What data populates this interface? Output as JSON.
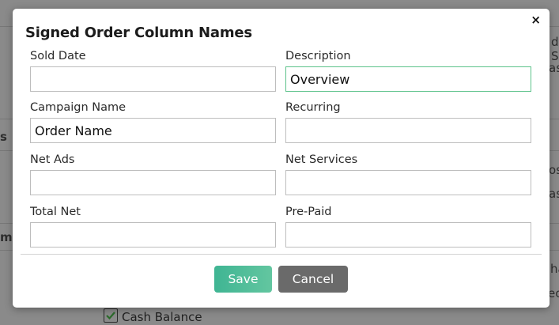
{
  "modal": {
    "title": "Signed Order Column Names",
    "close_label": "×",
    "fields": [
      {
        "label": "Sold Date",
        "value": ""
      },
      {
        "label": "Description",
        "value": "Overview"
      },
      {
        "label": "Campaign Name",
        "value": "Order Name"
      },
      {
        "label": "Recurring",
        "value": ""
      },
      {
        "label": "Net Ads",
        "value": ""
      },
      {
        "label": "Net Services",
        "value": ""
      },
      {
        "label": "Total Net",
        "value": ""
      },
      {
        "label": "Pre-Paid",
        "value": ""
      }
    ],
    "save_label": "Save",
    "cancel_label": "Cancel"
  },
  "background": {
    "checkbox_label": "Cash Balance",
    "checkbox_checked": true,
    "partial_texts": [
      "d S",
      "ast",
      "s",
      "os",
      "ash",
      "ms",
      "ha",
      "ec"
    ]
  },
  "colors": {
    "save_button": "#4fbc96",
    "cancel_button": "#6a6a6a",
    "focus_border": "#5cc28a",
    "overlay": "#8a8a8a"
  }
}
